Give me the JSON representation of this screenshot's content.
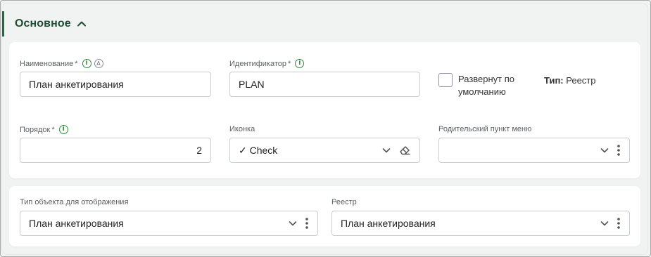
{
  "section": {
    "title": "Основное"
  },
  "fields": {
    "name": {
      "label": "Наименование",
      "required": "*",
      "value": "План анкетирования"
    },
    "identifier": {
      "label": "Идентификатор",
      "required": "*",
      "value": "PLAN"
    },
    "expanded": {
      "label": "Развернут по умолчанию",
      "checked": false
    },
    "type": {
      "key": "Тип:",
      "value": "Реестр"
    },
    "order": {
      "label": "Порядок",
      "required": "*",
      "value": "2"
    },
    "icon": {
      "label": "Иконка",
      "check": "✓",
      "value": "Check"
    },
    "parent": {
      "label": "Родительский пункт меню",
      "value": ""
    },
    "object_type": {
      "label": "Тип объекта для отображения",
      "value": "План анкетирования"
    },
    "registry": {
      "label": "Реестр",
      "value": "План анкетирования"
    }
  },
  "icons": {
    "info": "info-icon",
    "auto": "A",
    "chevron": "chevron-down-icon",
    "eraser": "eraser-icon",
    "kebab": "kebab-menu-icon"
  },
  "colors": {
    "accent": "#1f6b3d",
    "info": "#2e8b3e",
    "border": "#c9cdd0"
  }
}
